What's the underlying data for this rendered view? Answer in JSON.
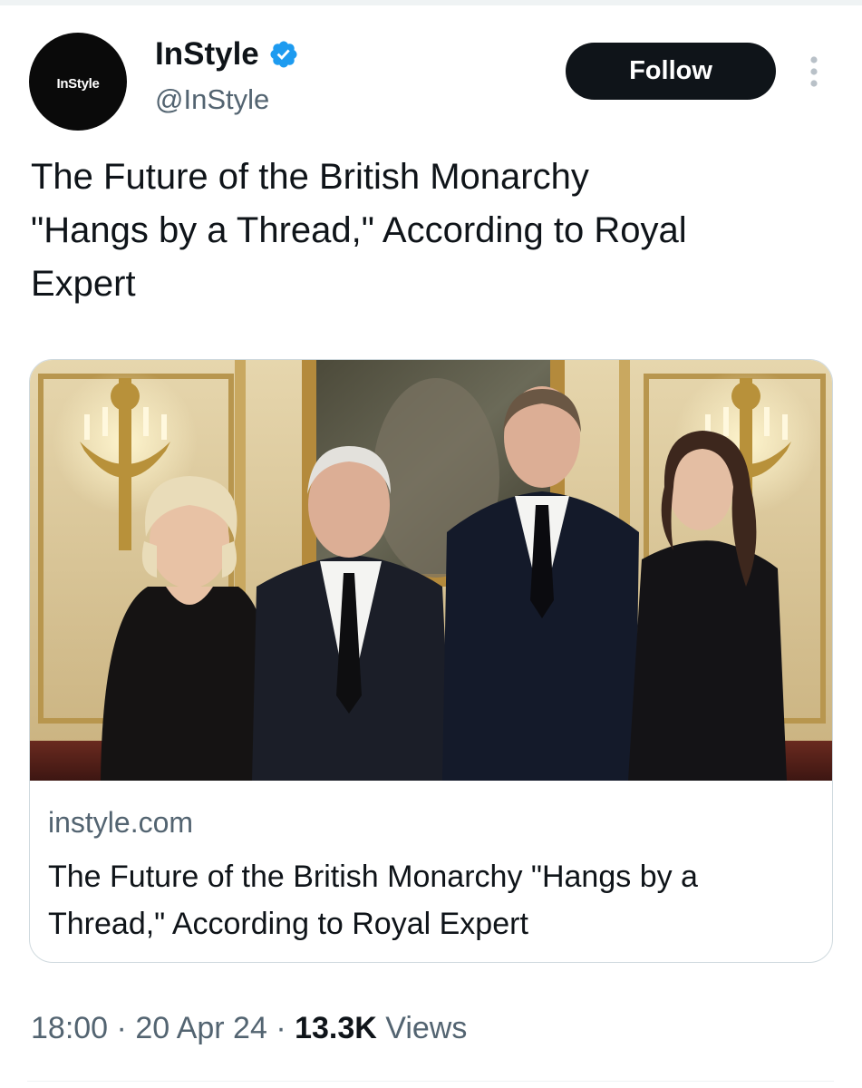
{
  "tweet": {
    "avatar": {
      "logo_text": "InStyle",
      "icon": "instyle-logo-avatar"
    },
    "author": {
      "name": "InStyle",
      "handle": "@InStyle",
      "verified_icon": "verified-badge-icon"
    },
    "follow_label": "Follow",
    "more_icon": "more-vertical-icon",
    "text": "The Future of the British Monarchy\n\"Hangs by a Thread,\" According to Royal\nExpert",
    "card": {
      "domain": "instyle.com",
      "title": "The Future of the British Monarchy \"Hangs by a Thread,\" According to Royal Expert"
    },
    "meta": {
      "time": "18:00",
      "separator": " · ",
      "date": "20 Apr 24",
      "views_count": "13.3K",
      "views_label": "Views"
    }
  },
  "colors": {
    "text_primary": "#0f1419",
    "text_secondary": "#536471",
    "verified_blue": "#1d9bf0",
    "border": "#cfd9de",
    "follow_bg": "#0f1419"
  }
}
